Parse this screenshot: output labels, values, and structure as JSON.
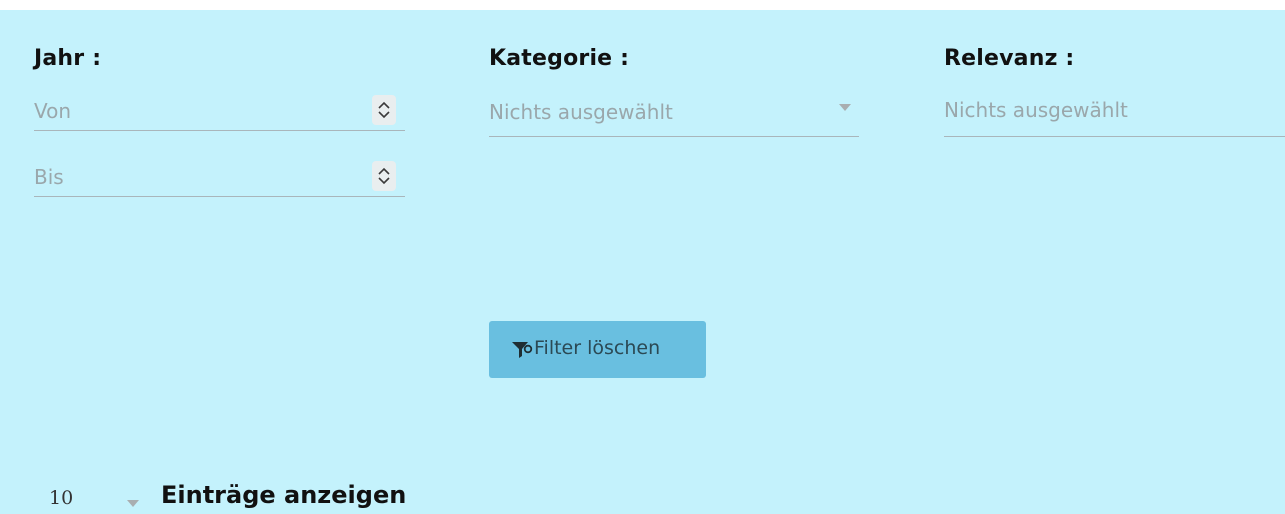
{
  "filters": {
    "year": {
      "label": "Jahr :",
      "from_placeholder": "Von",
      "to_placeholder": "Bis"
    },
    "category": {
      "label": "Kategorie :",
      "selected": "Nichts ausgewählt"
    },
    "relevance": {
      "label": "Relevanz :",
      "selected": "Nichts ausgewählt"
    }
  },
  "actions": {
    "clear_filter_label": "Filter löschen"
  },
  "entries": {
    "page_size": "10",
    "label": "Einträge anzeigen"
  },
  "colors": {
    "panel_background": "#c4f2fc",
    "button_background": "#69bfe0",
    "placeholder_text": "#9aa7ab"
  },
  "icons": {
    "spinner": "up-down-chevron-icon",
    "dropdown": "caret-down-icon",
    "clear_filter": "filter-remove-icon"
  }
}
